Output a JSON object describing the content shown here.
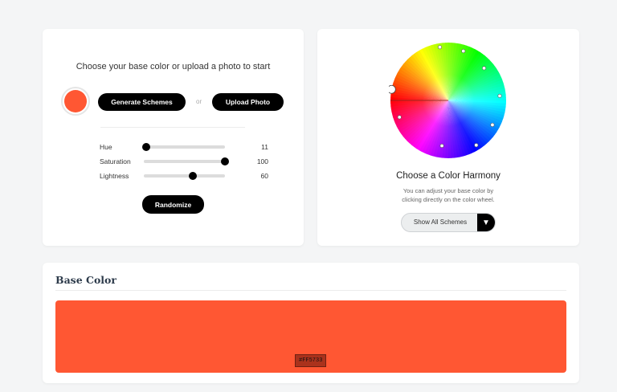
{
  "left_panel": {
    "prompt": "Choose your base color or upload a photo to start",
    "base_swatch_color": "#FF5733",
    "generate_label": "Generate Schemes",
    "or_label": "or",
    "upload_label": "Upload Photo",
    "sliders": [
      {
        "label": "Hue",
        "value": "11",
        "fraction": 0.0306
      },
      {
        "label": "Saturation",
        "value": "100",
        "fraction": 1.0
      },
      {
        "label": "Lightness",
        "value": "60",
        "fraction": 0.6
      }
    ],
    "randomize_label": "Randomize"
  },
  "right_panel": {
    "harmony_title": "Choose a Color Harmony",
    "harmony_desc_line1": "You can adjust your base color by",
    "harmony_desc_line2": "clicking directly on the color wheel.",
    "scheme_select": "Show All Schemes",
    "select_arrow": "▼",
    "wheel_markers": [
      {
        "hue": 11,
        "sat": 1.0,
        "primary": true
      },
      {
        "hue": 81,
        "sat": 0.96
      },
      {
        "hue": 107,
        "sat": 0.92
      },
      {
        "hue": 138,
        "sat": 0.86
      },
      {
        "hue": 175,
        "sat": 0.92
      },
      {
        "hue": 209,
        "sat": 0.9
      },
      {
        "hue": 238,
        "sat": 0.94
      },
      {
        "hue": 278,
        "sat": 0.82
      },
      {
        "hue": 341,
        "sat": 0.92
      }
    ]
  },
  "base_section": {
    "title": "Base Color",
    "color": "#FF5733",
    "hex_label": "#FF5733"
  }
}
